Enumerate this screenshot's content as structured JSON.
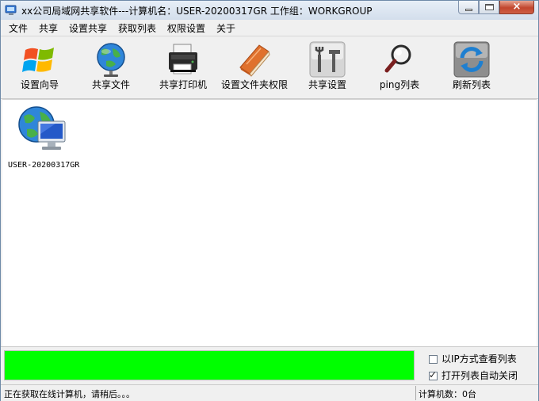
{
  "window": {
    "title": "xx公司局域网共享软件---计算机名：USER-20200317GR  工作组：WORKGROUP",
    "close_glyph": "×"
  },
  "menu": {
    "items": [
      {
        "label": "文件"
      },
      {
        "label": "共享"
      },
      {
        "label": "设置共享"
      },
      {
        "label": "获取列表"
      },
      {
        "label": "权限设置"
      },
      {
        "label": "关于"
      }
    ]
  },
  "toolbar": {
    "tools": [
      {
        "label": "设置向导",
        "icon": "windows-logo-icon"
      },
      {
        "label": "共享文件",
        "icon": "globe-icon"
      },
      {
        "label": "共享打印机",
        "icon": "printer-icon"
      },
      {
        "label": "设置文件夹权限",
        "icon": "book-icon"
      },
      {
        "label": "共享设置",
        "icon": "tools-icon"
      },
      {
        "label": "ping列表",
        "icon": "magnifier-icon"
      },
      {
        "label": "刷新列表",
        "icon": "refresh-icon"
      }
    ]
  },
  "computers": [
    {
      "name": "USER-20200317GR",
      "icon": "network-computer-icon"
    }
  ],
  "progress": {
    "value": 1.0,
    "color": "#00ff00"
  },
  "options": {
    "view_by_ip": {
      "label": "以IP方式查看列表",
      "checked": false
    },
    "auto_close": {
      "label": "打开列表自动关闭",
      "checked": true,
      "tick": "✓"
    }
  },
  "status": {
    "message": "正在获取在线计算机，请稍后。。。",
    "count": "计算机数：0台"
  }
}
